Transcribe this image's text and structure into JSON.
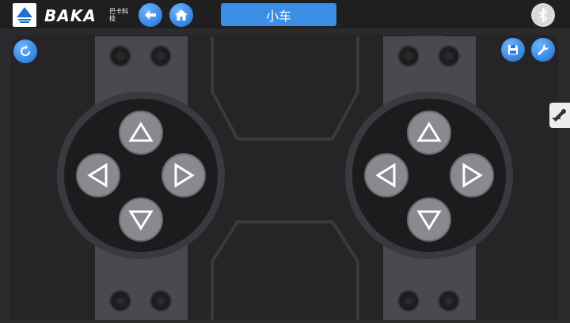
{
  "app": {
    "title": "小车",
    "brand_name": "BAKA",
    "brand_sub": "巴卡科技"
  },
  "icons": {
    "logo": "logo-icon",
    "back": "back-arrow-icon",
    "home": "home-icon",
    "bluetooth": "bluetooth-icon",
    "refresh": "refresh-icon",
    "save": "save-icon",
    "settings": "wrench-icon",
    "side": "tool-icon"
  },
  "colors": {
    "accent": "#3b8ee6",
    "background": "#2a2a2c",
    "plate": "#4a4a4e",
    "pad": "#1c1c1f",
    "button": "#8a8a8e"
  },
  "pads": [
    {
      "name": "left-dpad",
      "buttons": [
        "up",
        "left",
        "right",
        "down"
      ]
    },
    {
      "name": "right-dpad",
      "buttons": [
        "up",
        "left",
        "right",
        "down"
      ]
    }
  ]
}
